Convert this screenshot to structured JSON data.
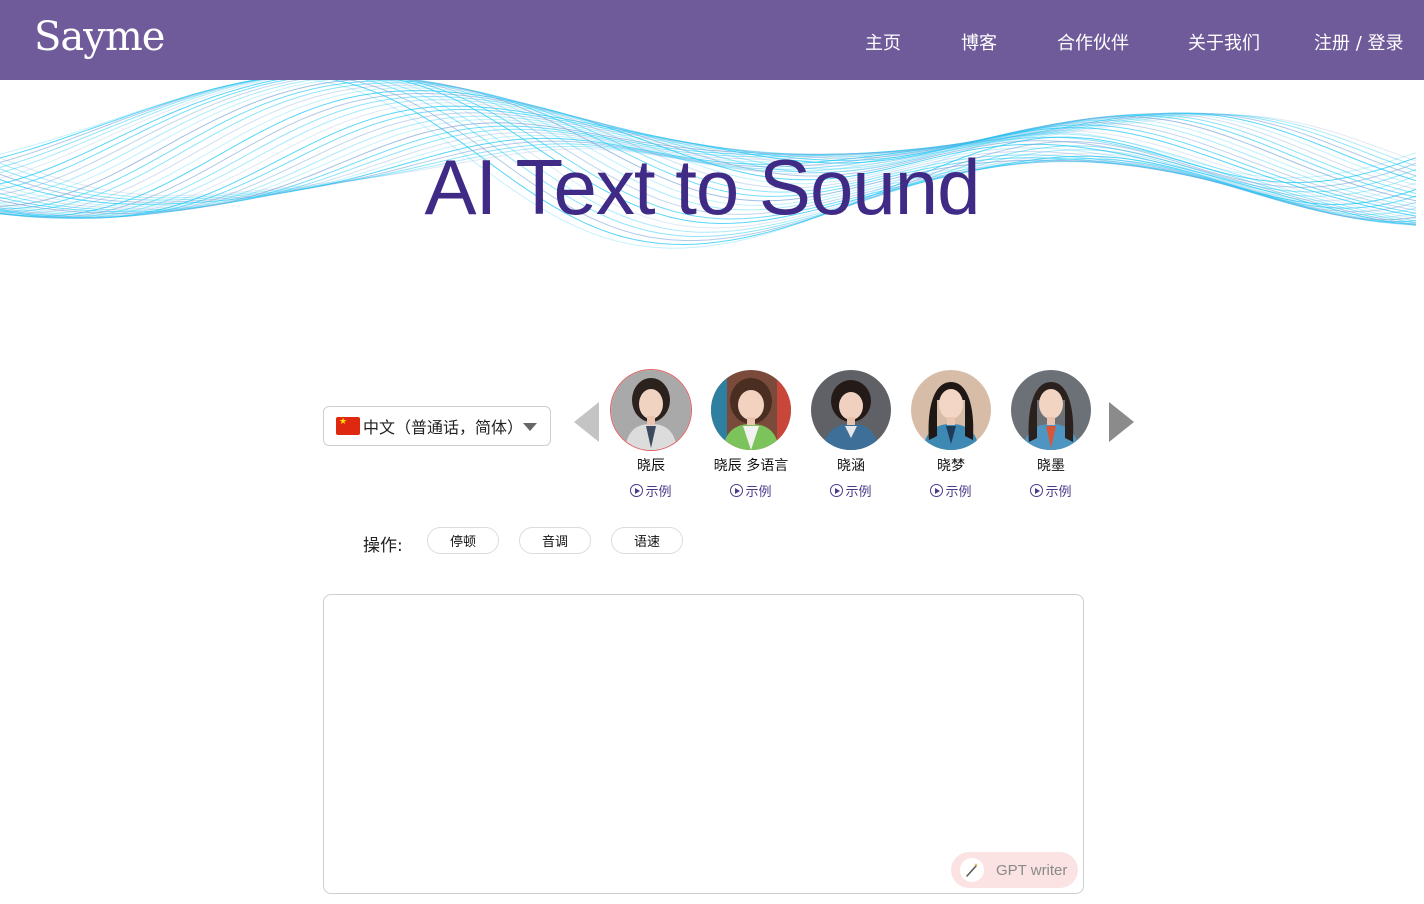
{
  "header": {
    "logo": "Sayme",
    "nav": [
      {
        "label": "主页"
      },
      {
        "label": "博客"
      },
      {
        "label": "合作伙伴"
      },
      {
        "label": "关于我们"
      },
      {
        "label": "注册 / 登录"
      }
    ],
    "background_color": "#6f5a9a"
  },
  "hero": {
    "title": "AI Text to Sound",
    "title_color": "#3f2a86",
    "wave_color": "#19c6f5"
  },
  "language_select": {
    "value": "中文（普通话，简体）",
    "flag": "china-flag"
  },
  "voices": [
    {
      "name": "晓辰",
      "sample_label": "示例",
      "selected": true
    },
    {
      "name": "晓辰 多语言",
      "sample_label": "示例",
      "selected": false
    },
    {
      "name": "晓涵",
      "sample_label": "示例",
      "selected": false
    },
    {
      "name": "晓梦",
      "sample_label": "示例",
      "selected": false
    },
    {
      "name": "晓墨",
      "sample_label": "示例",
      "selected": false
    }
  ],
  "operations": {
    "label": "操作:",
    "buttons": [
      {
        "label": "停顿"
      },
      {
        "label": "音调"
      },
      {
        "label": "语速"
      }
    ]
  },
  "editor": {
    "value": "",
    "placeholder": ""
  },
  "gpt_writer": {
    "label": "GPT writer",
    "icon": "magic-wand-icon"
  }
}
